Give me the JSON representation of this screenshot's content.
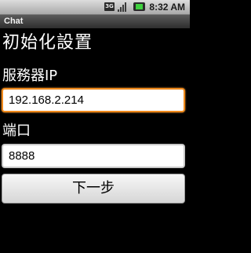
{
  "status_bar": {
    "network_label": "3G",
    "time": "8:32 AM",
    "icons": [
      "3g-icon",
      "signal-icon",
      "battery-icon"
    ]
  },
  "app": {
    "title": "Chat"
  },
  "form": {
    "title": "初始化設置",
    "server_ip_label": "服務器IP",
    "server_ip_value": "192.168.2.214",
    "port_label": "端口",
    "port_value": "8888",
    "next_button": "下一步"
  },
  "colors": {
    "background": "#000000",
    "focus_border": "#f08a1c",
    "battery_green": "#3fd13f"
  }
}
